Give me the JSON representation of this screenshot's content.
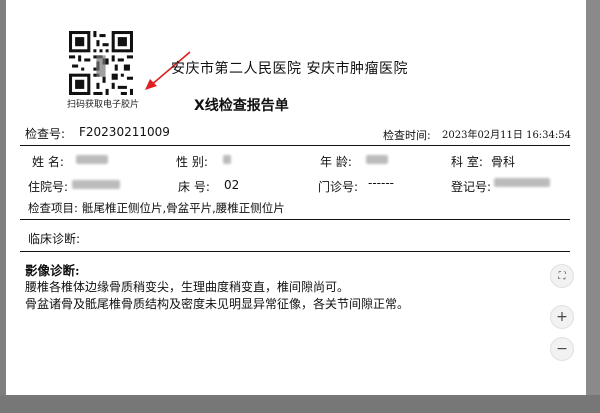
{
  "qr": {
    "caption": "扫码获取电子胶片"
  },
  "header": {
    "hospital": "安庆市第二人民医院  安庆市肿瘤医院",
    "title": "X线检查报告单"
  },
  "exam": {
    "no_label": "检查号:",
    "no_value": "F20230211009",
    "time_label": "检查时间:",
    "time_value": "2023年02月11日 16:34:54"
  },
  "patient": {
    "name_label": "姓 名:",
    "sex_label": "性 别:",
    "age_label": "年 龄:",
    "dept_label": "科 室:",
    "dept_value": "骨科",
    "inpatient_label": "住院号:",
    "bed_label": "床 号:",
    "bed_value": "02",
    "outpatient_label": "门诊号:",
    "outpatient_value": "------",
    "register_label": "登记号:"
  },
  "items": {
    "label": "检查项目:",
    "value": "骶尾椎正侧位片,骨盆平片,腰椎正侧位片"
  },
  "clinical": {
    "label": "临床诊断:"
  },
  "report": {
    "heading": "影像诊断:",
    "line1": "腰椎各椎体边缘骨质稍变尖，生理曲度稍变直，椎间隙尚可。",
    "line2": "骨盆诸骨及骶尾椎骨质结构及密度未见明显异常征像，各关节间隙正常。"
  },
  "controls": {
    "fit": "⛶",
    "zoom_in": "+",
    "zoom_out": "−"
  },
  "colors": {
    "arrow": "#e02020"
  }
}
